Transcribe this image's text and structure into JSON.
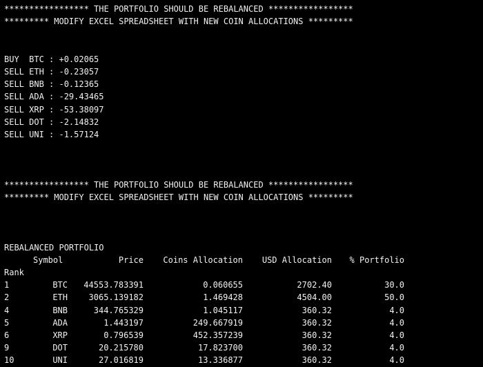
{
  "colors": {
    "background": "#000000",
    "text": "#f2f2f2"
  },
  "block1": {
    "banner1": "***************** THE PORTFOLIO SHOULD BE REBALANCED *****************",
    "banner2": "********* MODIFY EXCEL SPREADSHEET WITH NEW COIN ALLOCATIONS *********",
    "actions": [
      "BUY  BTC : +0.02065",
      "SELL ETH : -0.23057",
      "SELL BNB : -0.12365",
      "SELL ADA : -29.43465",
      "SELL XRP : -53.38097",
      "SELL DOT : -2.14832",
      "SELL UNI : -1.57124"
    ]
  },
  "block2": {
    "banner1": "***************** THE PORTFOLIO SHOULD BE REBALANCED *****************",
    "banner2": "********* MODIFY EXCEL SPREADSHEET WITH NEW COIN ALLOCATIONS *********"
  },
  "table": {
    "title": "REBALANCED PORTFOLIO",
    "headers": {
      "symbol": "Symbol",
      "price": "Price",
      "coins": "Coins Allocation",
      "usd": "USD Allocation",
      "pct": "% Portfolio"
    },
    "index_label": "Rank",
    "rows": [
      {
        "rank": "1",
        "symbol": "BTC",
        "price": "44553.783391",
        "coins": "0.060655",
        "usd": "2702.40",
        "pct": "30.0"
      },
      {
        "rank": "2",
        "symbol": "ETH",
        "price": "3065.139182",
        "coins": "1.469428",
        "usd": "4504.00",
        "pct": "50.0"
      },
      {
        "rank": "4",
        "symbol": "BNB",
        "price": "344.765329",
        "coins": "1.045117",
        "usd": "360.32",
        "pct": "4.0"
      },
      {
        "rank": "5",
        "symbol": "ADA",
        "price": "1.443197",
        "coins": "249.667919",
        "usd": "360.32",
        "pct": "4.0"
      },
      {
        "rank": "6",
        "symbol": "XRP",
        "price": "0.796539",
        "coins": "452.357239",
        "usd": "360.32",
        "pct": "4.0"
      },
      {
        "rank": "9",
        "symbol": "DOT",
        "price": "20.215780",
        "coins": "17.823700",
        "usd": "360.32",
        "pct": "4.0"
      },
      {
        "rank": "10",
        "symbol": "UNI",
        "price": "27.016819",
        "coins": "13.336877",
        "usd": "360.32",
        "pct": "4.0"
      }
    ]
  }
}
